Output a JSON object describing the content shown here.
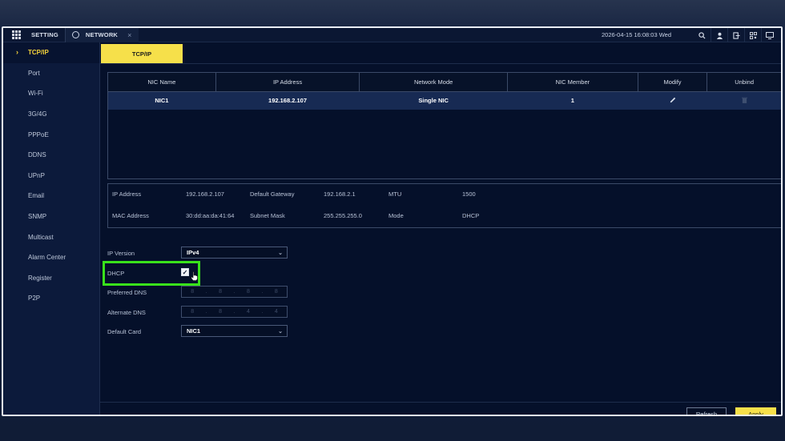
{
  "topbar": {
    "tab_setting": "SETTING",
    "tab_network": "NETWORK",
    "close": "×",
    "datetime": "2026-04-15 16:08:03 Wed",
    "icons": [
      "search-icon",
      "user-icon",
      "logout-icon",
      "qr-icon",
      "monitor-icon"
    ]
  },
  "sidebar": {
    "items": [
      {
        "label": "TCP/IP",
        "active": true
      },
      {
        "label": "Port"
      },
      {
        "label": "Wi-Fi"
      },
      {
        "label": "3G/4G"
      },
      {
        "label": "PPPoE"
      },
      {
        "label": "DDNS"
      },
      {
        "label": "UPnP"
      },
      {
        "label": "Email"
      },
      {
        "label": "SNMP"
      },
      {
        "label": "Multicast"
      },
      {
        "label": "Alarm Center"
      },
      {
        "label": "Register"
      },
      {
        "label": "P2P"
      }
    ]
  },
  "subtab": "TCP/IP",
  "nic_table": {
    "headers": [
      "NIC Name",
      "IP Address",
      "Network Mode",
      "NIC Member",
      "Modify",
      "Unbind"
    ],
    "rows": [
      {
        "name": "NIC1",
        "ip": "192.168.2.107",
        "mode": "Single NIC",
        "member": "1"
      }
    ]
  },
  "info": {
    "ip_label": "IP Address",
    "ip_value": "192.168.2.107",
    "gateway_label": "Default Gateway",
    "gateway_value": "192.168.2.1",
    "mtu_label": "MTU",
    "mtu_value": "1500",
    "mac_label": "MAC Address",
    "mac_value": "30:dd:aa:da:41:64",
    "mask_label": "Subnet Mask",
    "mask_value": "255.255.255.0",
    "mode_label": "Mode",
    "mode_value": "DHCP"
  },
  "form": {
    "ip_version_label": "IP Version",
    "ip_version_value": "IPv4",
    "dhcp_label": "DHCP",
    "dhcp_checked": true,
    "preferred_dns_label": "Preferred DNS",
    "preferred_dns": [
      "8",
      "8",
      "8",
      "8"
    ],
    "alternate_dns_label": "Alternate DNS",
    "alternate_dns": [
      "8",
      "8",
      "4",
      "4"
    ],
    "default_card_label": "Default Card",
    "default_card_value": "NIC1"
  },
  "buttons": {
    "refresh": "Refresh",
    "apply": "Apply"
  },
  "colors": {
    "accent": "#f6e04a",
    "highlight": "#39e21b",
    "background": "#05102a"
  }
}
